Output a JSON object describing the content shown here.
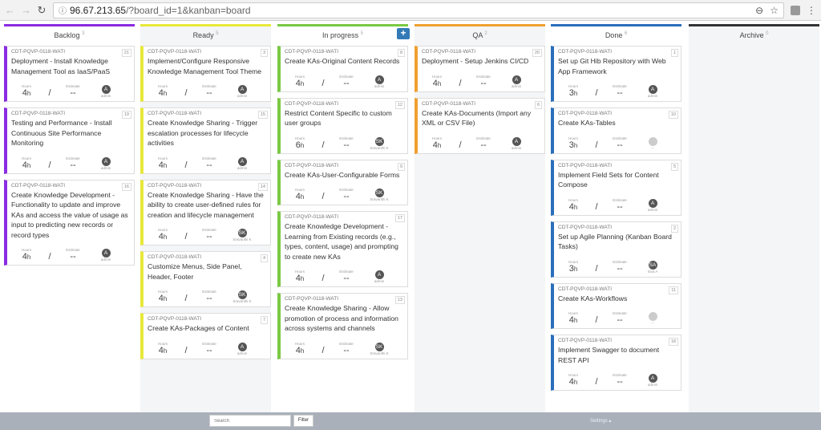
{
  "browser": {
    "url_host": "96.67.213.65",
    "url_rest": "/?board_id=1&kanban=board"
  },
  "labels": {
    "hours": "Hours",
    "estimate": "Estimate",
    "slash": "/",
    "add": "+"
  },
  "columns": [
    {
      "name": "Backlog",
      "count": "3",
      "color": "#8a2be2",
      "alt": false,
      "cards": [
        {
          "id": "CDT-PQVP-0118-WATI",
          "num": "21",
          "title": "Deployment - Install Knowledge Management Tool as IaaS/PaaS",
          "hours": "4",
          "unit": "h",
          "estimate": "--",
          "avatar": "A",
          "user": "admin"
        },
        {
          "id": "CDT-PQVP-0118-WATI",
          "num": "19",
          "title": "Testing and Performance - Install Continuous Site Performance Monitoring",
          "hours": "4",
          "unit": "h",
          "estimate": "--",
          "avatar": "A",
          "user": "admin"
        },
        {
          "id": "CDT-PQVP-0118-WATI",
          "num": "16",
          "title": "Create Knowledge Development - Functionality to update and improve KAs and access the value of usage as input to predicting new records or record types",
          "hours": "4",
          "unit": "h",
          "estimate": "--",
          "avatar": "A",
          "user": "admin"
        }
      ]
    },
    {
      "name": "Ready",
      "count": "5",
      "color": "#e8e83a",
      "alt": true,
      "cards": [
        {
          "id": "CDT-PQVP-0118-WATI",
          "num": "3",
          "title": "Implement/Configure Responsive Knowledge Management Tool Theme",
          "hours": "4",
          "unit": "h",
          "estimate": "--",
          "avatar": "A",
          "user": "admin"
        },
        {
          "id": "CDT-PQVP-0118-WATI",
          "num": "15",
          "title": "Create Knowledge Sharing - Trigger escalation processes for lifecycle activities",
          "hours": "4",
          "unit": "h",
          "estimate": "--",
          "avatar": "A",
          "user": "admin"
        },
        {
          "id": "CDT-PQVP-0118-WATI",
          "num": "14",
          "title": "Create Knowledge Sharing - Have the ability to create user-defined rules for creation and lifecycle management",
          "hours": "4",
          "unit": "h",
          "estimate": "--",
          "avatar": "SK",
          "user": "Sravanthi K"
        },
        {
          "id": "CDT-PQVP-0118-WATI",
          "num": "4",
          "title": "Customize Menus, Side Panel, Header, Footer",
          "hours": "4",
          "unit": "h",
          "estimate": "--",
          "avatar": "SK",
          "user": "Sravanthi K"
        },
        {
          "id": "CDT-PQVP-0118-WATI",
          "num": "7",
          "title": "Create KAs-Packages of Content",
          "hours": "4",
          "unit": "h",
          "estimate": "--",
          "avatar": "A",
          "user": "admin"
        }
      ]
    },
    {
      "name": "In progress",
      "count": "5",
      "color": "#7ac943",
      "alt": false,
      "add": true,
      "cards": [
        {
          "id": "CDT-PQVP-0118-WATI",
          "num": "8",
          "title": "Create KAs-Original Content Records",
          "hours": "4",
          "unit": "h",
          "estimate": "--",
          "avatar": "A",
          "user": "admin"
        },
        {
          "id": "CDT-PQVP-0118-WATI",
          "num": "12",
          "title": "Restrict Content Specific to custom user groups",
          "hours": "6",
          "unit": "h",
          "estimate": "--",
          "avatar": "SK",
          "user": "Sravanthi K"
        },
        {
          "id": "CDT-PQVP-0118-WATI",
          "num": "9",
          "title": "Create KAs-User-Configurable Forms",
          "hours": "4",
          "unit": "h",
          "estimate": "--",
          "avatar": "SK",
          "user": "Sravanthi K"
        },
        {
          "id": "CDT-PQVP-0118-WATI",
          "num": "17",
          "title": "Create Knowledge Development - Learning from Existing records (e.g., types, content, usage) and prompting to create new KAs",
          "hours": "4",
          "unit": "h",
          "estimate": "--",
          "avatar": "A",
          "user": "admin"
        },
        {
          "id": "CDT-PQVP-0118-WATI",
          "num": "13",
          "title": "Create Knowledge Sharing - Allow promotion of process and information across systems and channels",
          "hours": "4",
          "unit": "h",
          "estimate": "--",
          "avatar": "SK",
          "user": "Sravanthi K"
        }
      ]
    },
    {
      "name": "QA",
      "count": "2",
      "color": "#f0a030",
      "alt": true,
      "cards": [
        {
          "id": "CDT-PQVP-0118-WATI",
          "num": "20",
          "title": "Deployment - Setup Jenkins CI/CD",
          "hours": "4",
          "unit": "h",
          "estimate": "--",
          "avatar": "A",
          "user": "admin"
        },
        {
          "id": "CDT-PQVP-0118-WATI",
          "num": "6",
          "title": "Create KAs-Documents (Import any XML or CSV File)",
          "hours": "4",
          "unit": "h",
          "estimate": "--",
          "avatar": "A",
          "user": "admin"
        }
      ]
    },
    {
      "name": "Done",
      "count": "6",
      "color": "#2a6ebb",
      "alt": false,
      "cards": [
        {
          "id": "CDT-PQVP-0118-WATI",
          "num": "1",
          "title": "Set up Git Hib Repository with Web App Framework",
          "hours": "3",
          "unit": "h",
          "estimate": "--",
          "avatar": "A",
          "user": "admin"
        },
        {
          "id": "CDT-PQVP-0118-WATI",
          "num": "10",
          "title": "Create KAs-Tables",
          "hours": "3",
          "unit": "h",
          "estimate": "--",
          "avatar": "",
          "user": "--"
        },
        {
          "id": "CDT-PQVP-0118-WATI",
          "num": "5",
          "title": "Implement Field Sets for Content Compose",
          "hours": "4",
          "unit": "h",
          "estimate": "--",
          "avatar": "A",
          "user": "admin"
        },
        {
          "id": "CDT-PQVP-0118-WATI",
          "num": "2",
          "title": "Set up Agile Planning (Kanban Board Tasks)",
          "hours": "3",
          "unit": "h",
          "estimate": "--",
          "avatar": "SA",
          "user": "Siva A"
        },
        {
          "id": "CDT-PQVP-0118-WATI",
          "num": "11",
          "title": "Create KAs-Workflows",
          "hours": "4",
          "unit": "h",
          "estimate": "--",
          "avatar": "",
          "user": "--"
        },
        {
          "id": "CDT-PQVP-0118-WATI",
          "num": "18",
          "title": "Implement Swagger to document REST API",
          "hours": "4",
          "unit": "h",
          "estimate": "--",
          "avatar": "A",
          "user": "admin"
        }
      ]
    },
    {
      "name": "Archive",
      "count": "0",
      "color": "#333333",
      "alt": true,
      "cards": []
    }
  ],
  "footer": {
    "search_placeholder": "Search",
    "filter_label": "Filter",
    "settings_label": "Settings ▴"
  }
}
